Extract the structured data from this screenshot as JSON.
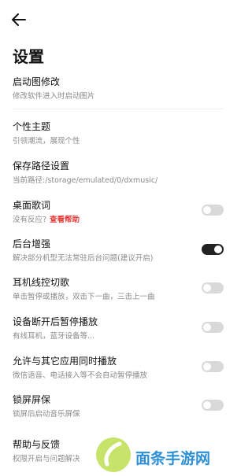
{
  "header": {
    "back_icon": "arrow-left-icon",
    "title": "设置"
  },
  "settings": [
    {
      "id": "startup-image",
      "title": "启动图修改",
      "subtitle": "修改软件进入时启动图片"
    },
    {
      "id": "theme",
      "title": "个性主题",
      "subtitle": "引领潮流，展现个性"
    },
    {
      "id": "save-path",
      "title": "保存路径设置",
      "subtitle": "当前路径:/storage/emulated/0/dxmusic/"
    },
    {
      "id": "desktop-lyrics",
      "title": "桌面歌词",
      "subtitle": "没有反应?",
      "link": "查看帮助",
      "toggle": false
    },
    {
      "id": "background-boost",
      "title": "后台增强",
      "subtitle": "解决部分机型无法常驻后台问题(建议开启)",
      "toggle": true
    },
    {
      "id": "headset-control",
      "title": "耳机线控切歌",
      "subtitle": "单击暂停或播放，双击下一曲，三击上一曲",
      "toggle": false
    },
    {
      "id": "pause-on-disconnect",
      "title": "设备断开后暂停播放",
      "subtitle": "有线耳机，蓝牙设备等...",
      "toggle": false
    },
    {
      "id": "allow-concurrent",
      "title": "允许与其它应用同时播放",
      "subtitle": "微信语音、电话接入等不会自动暂停播放",
      "toggle": false
    },
    {
      "id": "lockscreen",
      "title": "锁屏屏保",
      "subtitle": "锁屏后启动音乐屏保",
      "toggle": false
    },
    {
      "id": "help",
      "title": "帮助与反馈",
      "subtitle": "权限开启与问题解决"
    }
  ],
  "watermark": {
    "text": "面条手游网"
  },
  "colors": {
    "toggle_on": "#222222",
    "toggle_off": "#d9d9d9",
    "link": "#e53935"
  }
}
